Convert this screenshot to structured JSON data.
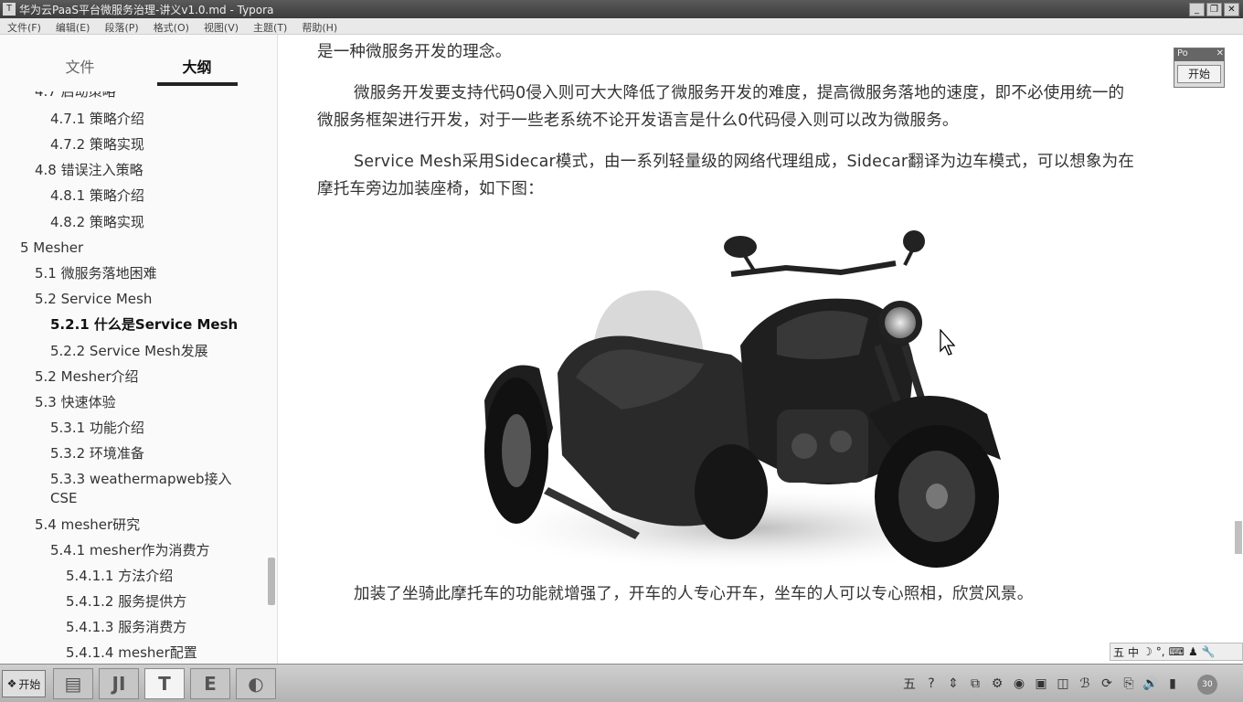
{
  "window": {
    "title": "华为云PaaS平台微服务治理-讲义v1.0.md - Typora",
    "controls": [
      "_",
      "❐",
      "✕"
    ]
  },
  "menu": [
    "文件(F)",
    "编辑(E)",
    "段落(P)",
    "格式(O)",
    "视图(V)",
    "主题(T)",
    "帮助(H)"
  ],
  "sidebar": {
    "tabs": [
      "文件",
      "大纲"
    ],
    "active_tab": "大纲",
    "outline": [
      {
        "label": "4.7 启动策略",
        "level": 2
      },
      {
        "label": "4.7.1 策略介绍",
        "level": 3
      },
      {
        "label": "4.7.2 策略实现",
        "level": 3
      },
      {
        "label": "4.8 错误注入策略",
        "level": 2
      },
      {
        "label": "4.8.1 策略介绍",
        "level": 3
      },
      {
        "label": "4.8.2 策略实现",
        "level": 3
      },
      {
        "label": "5 Mesher",
        "level": 1
      },
      {
        "label": "5.1 微服务落地困难",
        "level": 2
      },
      {
        "label": "5.2 Service Mesh",
        "level": 2
      },
      {
        "label": "5.2.1 什么是Service Mesh",
        "level": 3,
        "active": true
      },
      {
        "label": "5.2.2 Service Mesh发展",
        "level": 3
      },
      {
        "label": "5.2 Mesher介绍",
        "level": 2
      },
      {
        "label": "5.3 快速体验",
        "level": 2
      },
      {
        "label": "5.3.1 功能介绍",
        "level": 3
      },
      {
        "label": "5.3.2 环境准备",
        "level": 3
      },
      {
        "label": "5.3.3 weathermapweb接入",
        "level": 3
      },
      {
        "label": "CSE",
        "level": 3
      },
      {
        "label": "5.4 mesher研究",
        "level": 2
      },
      {
        "label": "5.4.1 mesher作为消费方",
        "level": 3
      },
      {
        "label": "5.4.1.1 方法介绍",
        "level": 4
      },
      {
        "label": "5.4.1.2 服务提供方",
        "level": 4
      },
      {
        "label": "5.4.1.3 服务消费方",
        "level": 4
      },
      {
        "label": "5.4.1.4 mesher配置",
        "level": 4
      }
    ],
    "footer": {
      "back": "<",
      "source": "</>"
    }
  },
  "content": {
    "p0": "是一种微服务开发的理念。",
    "p1_line1": "微服务开发要支持代码0侵入则可大大降低了微服务开发的难度，提高微服务落地的速度，即不必使用统一的",
    "p1_line2": "微服务框架进行开发，对于一些老系统不论开发语言是什么0代码侵入则可以改为微服务。",
    "p2_line1": "Service Mesh采用Sidecar模式，由一系列轻量级的网络代理组成，Sidecar翻译为边车模式，可以想象为在",
    "p2_line2": "摩托车旁边加装座椅，如下图：",
    "p3": "加装了坐骑此摩托车的功能就增强了，开车的人专心开车，坐车的人可以专心照相，欣赏风景。"
  },
  "float_window": {
    "title": "Po",
    "close": "✕",
    "button": "开始"
  },
  "ime": [
    "五",
    "中",
    "☽",
    "°,",
    "⌨",
    "♟",
    "🔧"
  ],
  "taskbar": {
    "start": "开始",
    "apps": [
      "▤",
      "JI",
      "T",
      "E",
      "◐"
    ],
    "tray": [
      "五",
      "?",
      "⇕",
      "⧉",
      "⚙",
      "◉",
      "▣",
      "◫",
      "ℬ",
      "⟳",
      "⎘",
      "🔊",
      "▮"
    ],
    "clock": "30"
  }
}
